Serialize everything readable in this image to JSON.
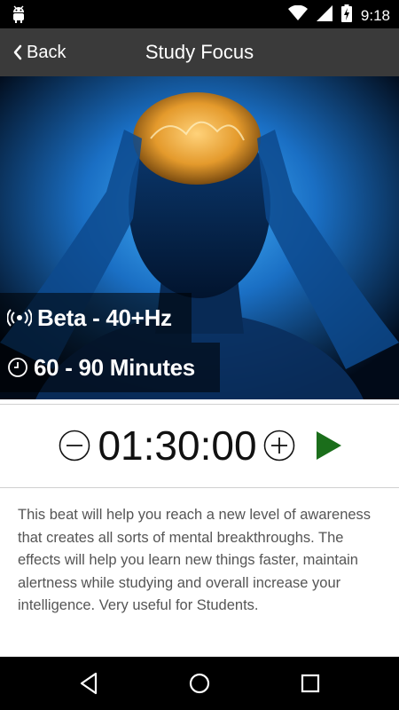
{
  "status_bar": {
    "time": "9:18",
    "icons": [
      "android-icon",
      "wifi-icon",
      "signal-icon",
      "battery-charging-icon"
    ]
  },
  "app_bar": {
    "back_label": "Back",
    "title": "Study Focus"
  },
  "hero": {
    "frequency_label": "Beta - 40+Hz",
    "duration_label": "60 - 90 Minutes",
    "frequency_icon": "broadcast-icon",
    "duration_icon": "clock-icon"
  },
  "timer": {
    "value": "01:30:00",
    "decrement_icon": "minus-circle-icon",
    "increment_icon": "plus-circle-icon",
    "play_icon": "play-icon",
    "play_color": "#1b6e1b"
  },
  "description": "This beat will help you reach a new level of awareness that creates all sorts of mental breakthroughs. The effects will help you learn new things faster, maintain alertness while studying and overall increase your intelligence. Very useful for Students.",
  "nav_bar": {
    "buttons": [
      "back-triangle-icon",
      "home-circle-icon",
      "recents-square-icon"
    ]
  }
}
